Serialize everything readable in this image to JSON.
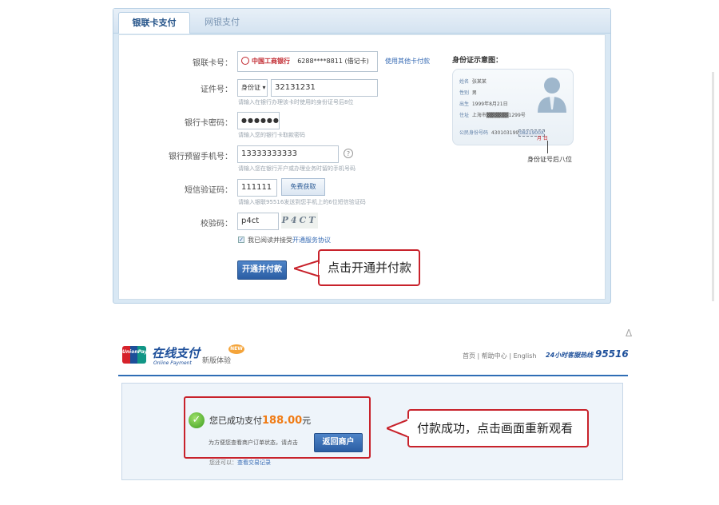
{
  "top_panel": {
    "tabs": [
      {
        "label": "银联卡支付",
        "active": true
      },
      {
        "label": "网银支付",
        "active": false
      }
    ],
    "form": {
      "card_number": {
        "label": "银联卡号：",
        "bank_name": "中国工商银行",
        "value": "6288****8811 (借记卡)",
        "other_card_link": "使用其他卡付款"
      },
      "id_number": {
        "label": "证件号：",
        "id_type": "身份证",
        "value": "32131231",
        "hint": "请输入在银行办理该卡时使用的身份证号后8位"
      },
      "password": {
        "label": "银行卡密码：",
        "value": "●●●●●●",
        "hint": "请输入您的银行卡取款密码"
      },
      "phone": {
        "label": "银行预留手机号：",
        "value": "13333333333",
        "help": "?",
        "hint": "请输入您在银行开户或办理业务时留的手机号码"
      },
      "sms": {
        "label": "短信验证码：",
        "value": "111111",
        "button": "免费获取",
        "hint": "请输入银联95516发送到您手机上的6位短信验证码"
      },
      "captcha": {
        "label": "校验码：",
        "value": "p4ct",
        "image_text": "P4CT"
      },
      "agreement": {
        "checked": true,
        "text": "我已阅读并接受",
        "link": "开通服务协议"
      },
      "submit_label": "开通并付款"
    },
    "id_sample": {
      "title": "身份证示意图：",
      "rows": [
        {
          "key": "姓名",
          "val": "张某某"
        },
        {
          "key": "性别",
          "val": "男"
        },
        {
          "key": "出生",
          "val": "1999年8月21日"
        },
        {
          "key": "住址",
          "val": "上海市▓▓▓▓▓▓1299号"
        }
      ],
      "id_label": "公民身份号码",
      "id_number_start": "430103199",
      "id_number_end": "08",
      "id_number_highlight": "21900X",
      "emblem_text": "月 日",
      "caption": "身份证号后八位"
    },
    "callout": "点击开通并付款"
  },
  "bottom_panel": {
    "brand": {
      "logo_text": "UnionPay",
      "title": "在线支付",
      "subtitle": "Online Payment",
      "new_experience": "新版体验",
      "new_badge": "NEW"
    },
    "nav": {
      "home": "首页",
      "help": "帮助中心",
      "english": "English",
      "hotline_label": "24小时客服热线",
      "hotline_number": "95516"
    },
    "success": {
      "prefix": "您已成功支付",
      "amount": "188.00",
      "suffix": "元",
      "return_hint": "为方便您查看商户订单状态，请点击",
      "return_button": "返回商户",
      "also_text": "您还可以：",
      "also_link": "查看交易记录"
    },
    "callout": "付款成功，点击画面重新观看"
  }
}
